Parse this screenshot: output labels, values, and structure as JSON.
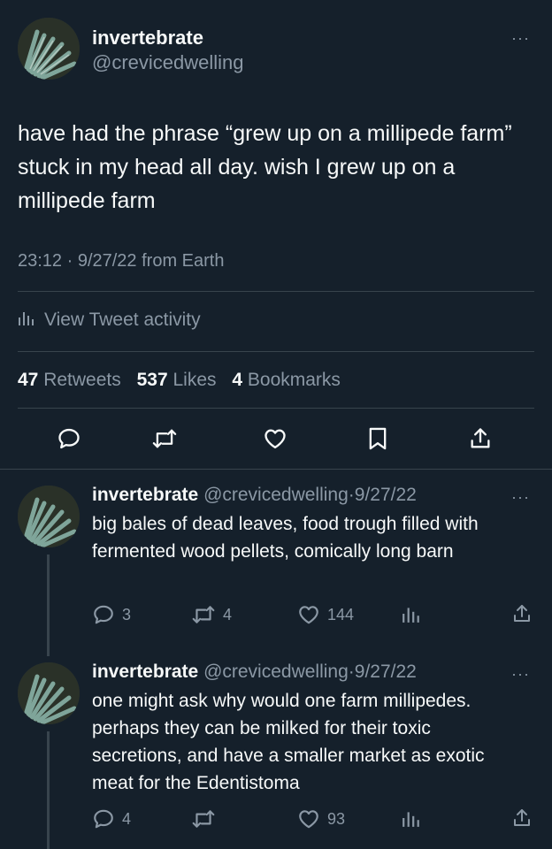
{
  "main": {
    "name": "invertebrate",
    "handle": "@crevicedwelling",
    "text": "have had the phrase “grew up on a millipede farm” stuck in my head all day. wish I grew up on a millipede farm",
    "meta": "23:12 · 9/27/22 from Earth",
    "activity_label": "View Tweet activity",
    "stats": {
      "retweets_count": "47",
      "retweets_label": "Retweets",
      "likes_count": "537",
      "likes_label": "Likes",
      "bookmarks_count": "4",
      "bookmarks_label": "Bookmarks"
    },
    "more_label": "···"
  },
  "replies": [
    {
      "name": "invertebrate",
      "handle": "@crevicedwelling",
      "date": "·9/27/22",
      "text": "big bales of dead leaves, food trough filled with fermented wood pellets, comically long barn",
      "replies": "3",
      "retweets": "4",
      "likes": "144",
      "more_label": "···"
    },
    {
      "name": "invertebrate",
      "handle": "@crevicedwelling",
      "date": "·9/27/22",
      "text": "one might ask why would one farm millipedes. perhaps they can be milked for their toxic secretions, and have a smaller market as exotic meat for the Edentistoma",
      "replies": "4",
      "retweets": "",
      "likes": "93",
      "more_label": "···"
    }
  ],
  "colors": {
    "background": "#15202b",
    "text": "#f7f9f9",
    "muted": "#8b98a5",
    "divider": "#38444d"
  },
  "icons": [
    "reply-icon",
    "retweet-icon",
    "like-icon",
    "bookmark-icon",
    "share-icon",
    "analytics-icon",
    "more-icon"
  ]
}
